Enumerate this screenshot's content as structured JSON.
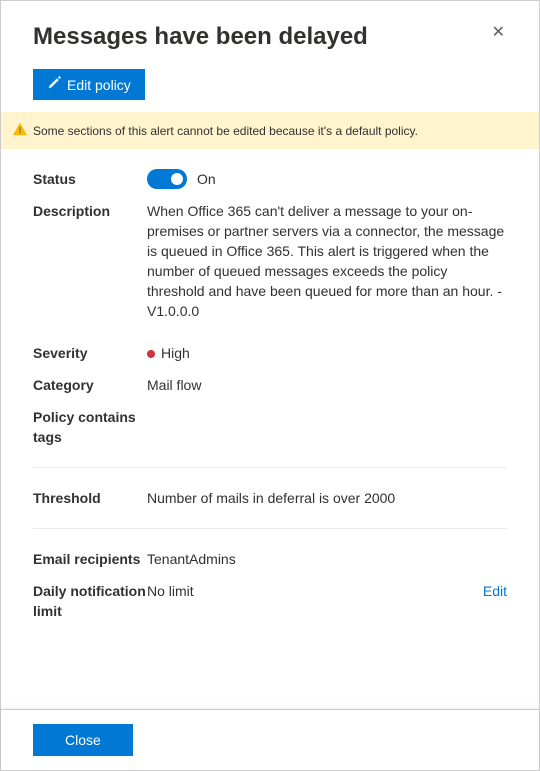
{
  "header": {
    "title": "Messages have been delayed"
  },
  "toolbar": {
    "edit_policy_label": "Edit policy"
  },
  "warning": {
    "text": "Some sections of this alert cannot be edited because it's a default policy."
  },
  "fields": {
    "status": {
      "label": "Status",
      "toggle_text": "On"
    },
    "description": {
      "label": "Description",
      "value": "When Office 365 can't deliver a message to your on-premises or partner servers via a connector, the message is queued in Office 365. This alert is triggered when the number of queued messages exceeds the policy threshold and have been queued for more than an hour. -V1.0.0.0"
    },
    "severity": {
      "label": "Severity",
      "value": "High",
      "color": "#d13438"
    },
    "category": {
      "label": "Category",
      "value": "Mail flow"
    },
    "policy_tags": {
      "label": "Policy contains tags",
      "value": ""
    },
    "threshold": {
      "label": "Threshold",
      "value": "Number of mails in deferral is over 2000"
    },
    "email_recipients": {
      "label": "Email recipients",
      "value": "TenantAdmins",
      "edit_label": "Edit"
    },
    "daily_limit": {
      "label": "Daily notification limit",
      "value": "No limit"
    }
  },
  "footer": {
    "close_label": "Close"
  }
}
